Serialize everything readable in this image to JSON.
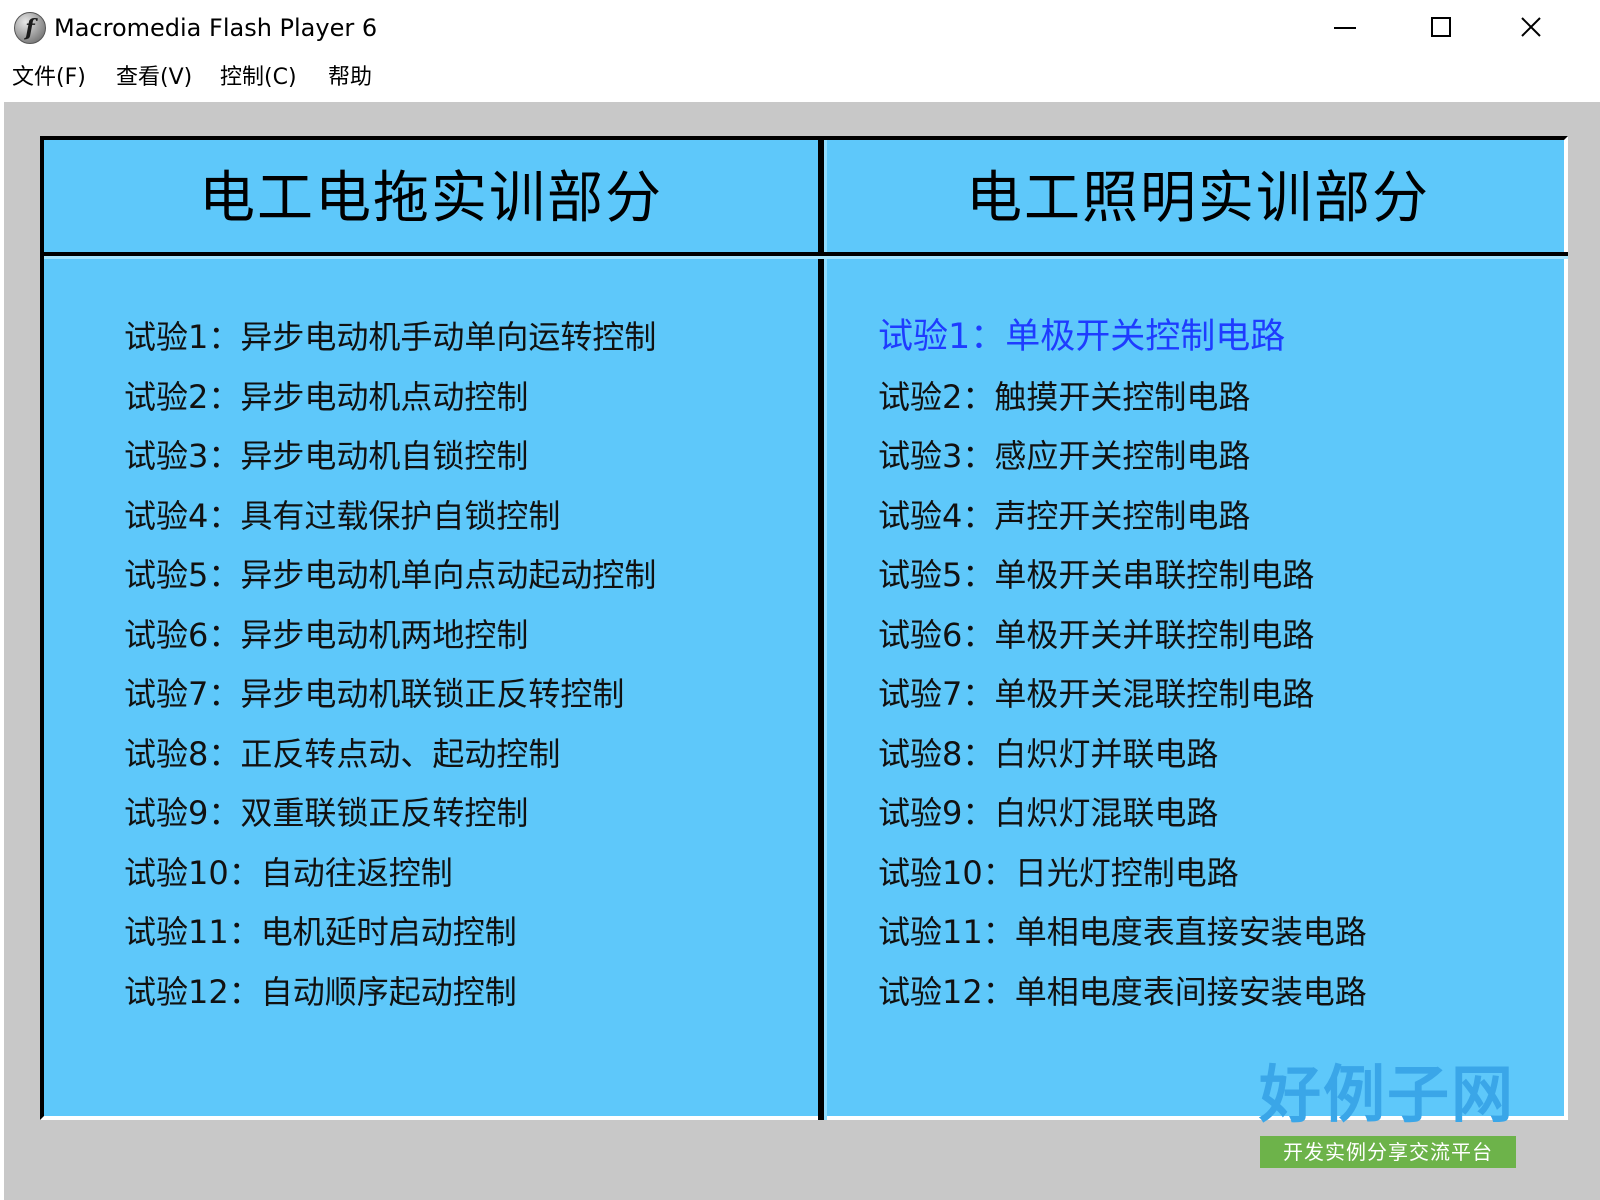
{
  "window": {
    "title": "Macromedia Flash Player 6",
    "icon": "flash-icon",
    "icon_glyph": "f"
  },
  "menu": [
    {
      "label": "文件(F)"
    },
    {
      "label": "查看(V)"
    },
    {
      "label": "控制(C)"
    },
    {
      "label": "帮助"
    }
  ],
  "left_panel": {
    "title": "电工电拖实训部分",
    "items": [
      {
        "label": "试验1：异步电动机手动单向运转控制"
      },
      {
        "label": "试验2：异步电动机点动控制"
      },
      {
        "label": "试验3：异步电动机自锁控制"
      },
      {
        "label": "试验4：具有过载保护自锁控制"
      },
      {
        "label": "试验5：异步电动机单向点动起动控制"
      },
      {
        "label": "试验6：异步电动机两地控制"
      },
      {
        "label": "试验7：异步电动机联锁正反转控制"
      },
      {
        "label": "试验8：正反转点动、起动控制"
      },
      {
        "label": "试验9：双重联锁正反转控制"
      },
      {
        "label": "试验10：自动往返控制"
      },
      {
        "label": "试验11：电机延时启动控制"
      },
      {
        "label": "试验12：自动顺序起动控制"
      }
    ]
  },
  "right_panel": {
    "title": "电工照明实训部分",
    "items": [
      {
        "label": "试验1：单极开关控制电路",
        "active": true
      },
      {
        "label": "试验2：触摸开关控制电路"
      },
      {
        "label": "试验3：感应开关控制电路"
      },
      {
        "label": "试验4：声控开关控制电路"
      },
      {
        "label": "试验5：单极开关串联控制电路"
      },
      {
        "label": "试验6：单极开关并联控制电路"
      },
      {
        "label": "试验7：单极开关混联控制电路"
      },
      {
        "label": "试验8：白炽灯并联电路"
      },
      {
        "label": "试验9：白炽灯混联电路"
      },
      {
        "label": "试验10：日光灯控制电路"
      },
      {
        "label": "试验11：单相电度表直接安装电路"
      },
      {
        "label": "试验12：单相电度表间接安装电路"
      }
    ]
  },
  "watermark": {
    "logo_text": "好例子网",
    "logo_subtext": "开发实例分享交流平台"
  },
  "colors": {
    "panel_bg": "#5ec8fa",
    "stage_bg": "#c8c8c8",
    "active_item": "#1e3cff"
  }
}
